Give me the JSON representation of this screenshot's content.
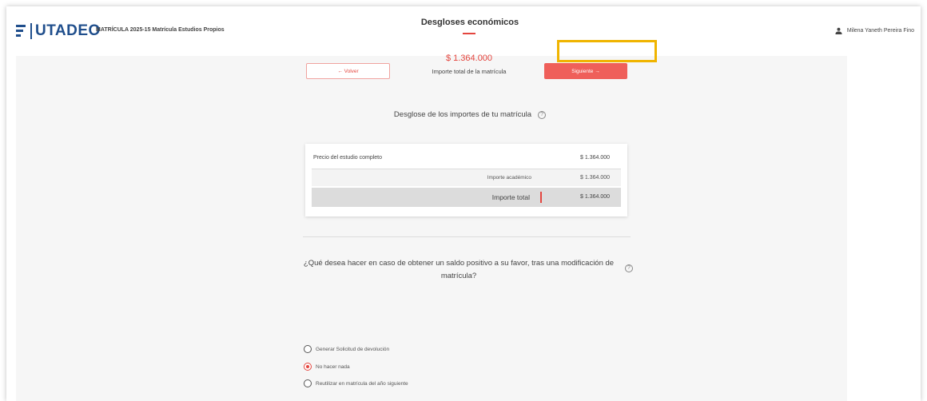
{
  "header": {
    "logo_text": "UTADEO",
    "breadcrumb": "MATRÍCULA 2025-15 Matrícula Estudios Propios",
    "user_name": "Milena Yaneth Pereira Fino"
  },
  "page": {
    "title": "Desgloses económicos",
    "back_button": "← Volver",
    "next_button": "Siguiente →",
    "total_amount": "$ 1.364.000",
    "total_label": "Importe total de la matrícula"
  },
  "breakdown": {
    "heading": "Desglose de los importes de tu matrícula",
    "rows": [
      {
        "label": "Precio del estudio completo",
        "value": "$ 1.364.000"
      },
      {
        "label": "Importe académico",
        "value": "$ 1.364.000"
      },
      {
        "label": "Importe total",
        "value": "$ 1.364.000"
      }
    ]
  },
  "refund_question": {
    "text": "¿Qué desea hacer en caso de obtener un saldo positivo a su favor, tras una modificación de matrícula?",
    "options": [
      {
        "label": "Generar Solicitud de devolución",
        "selected": false
      },
      {
        "label": "No hacer nada",
        "selected": true
      },
      {
        "label": "Reutilizar en matrícula del año siguiente",
        "selected": false
      }
    ]
  },
  "colors": {
    "accent": "#e4463f",
    "brand": "#1f4e8c",
    "highlight": "#f0b400"
  }
}
